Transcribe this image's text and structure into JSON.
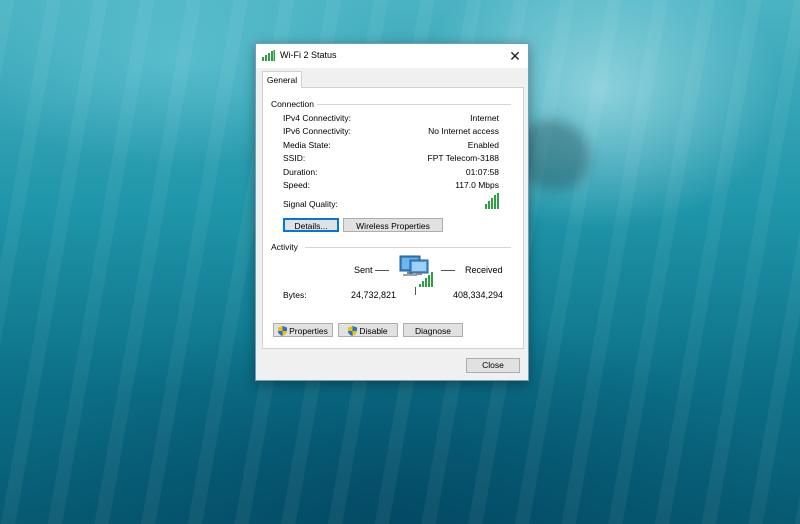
{
  "window": {
    "title": "Wi-Fi 2 Status",
    "close_glyph": "✕",
    "tab_label": "General"
  },
  "connection": {
    "group_label": "Connection",
    "rows": [
      {
        "label": "IPv4 Connectivity:",
        "value": "Internet"
      },
      {
        "label": "IPv6 Connectivity:",
        "value": "No Internet access"
      },
      {
        "label": "Media State:",
        "value": "Enabled"
      },
      {
        "label": "SSID:",
        "value": "FPT Telecom-3188"
      },
      {
        "label": "Duration:",
        "value": "01:07:58"
      },
      {
        "label": "Speed:",
        "value": "117.0 Mbps"
      }
    ],
    "signal_label": "Signal Quality:",
    "signal_icon": "signal-bars-icon",
    "details_button": "Details...",
    "wireless_button": "Wireless Properties"
  },
  "activity": {
    "group_label": "Activity",
    "sent_label": "Sent",
    "received_label": "Received",
    "bytes_label": "Bytes:",
    "bytes_sent": "24,732,821",
    "bytes_received": "408,334,294",
    "network_icon": "network-computers-icon"
  },
  "buttons": {
    "properties": "Properties",
    "disable": "Disable",
    "diagnose": "Diagnose",
    "close": "Close"
  },
  "colors": {
    "signal_green": "#2ea043",
    "focus_blue": "#0078d7"
  }
}
